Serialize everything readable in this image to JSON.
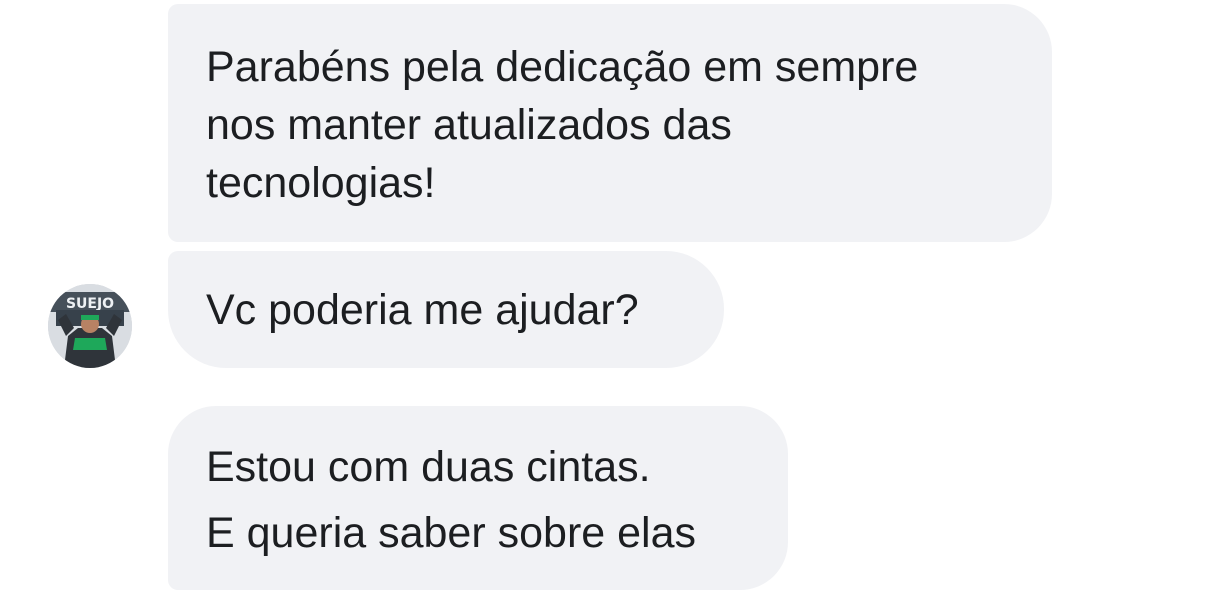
{
  "messages": [
    {
      "lines": [
        "Parabéns pela dedicação em sempre",
        "nos manter atualizados das",
        "tecnologias!"
      ]
    },
    {
      "lines": [
        "Vc poderia me ajudar?"
      ]
    },
    {
      "lines": [
        "Estou com duas cintas.",
        "E queria saber sobre elas"
      ]
    }
  ],
  "avatar": {
    "banner_text": "SUEJO",
    "accent_color": "#1ea85a"
  },
  "colors": {
    "bubble_bg": "#f1f2f5",
    "text": "#1c1e21",
    "page_bg": "#ffffff"
  }
}
